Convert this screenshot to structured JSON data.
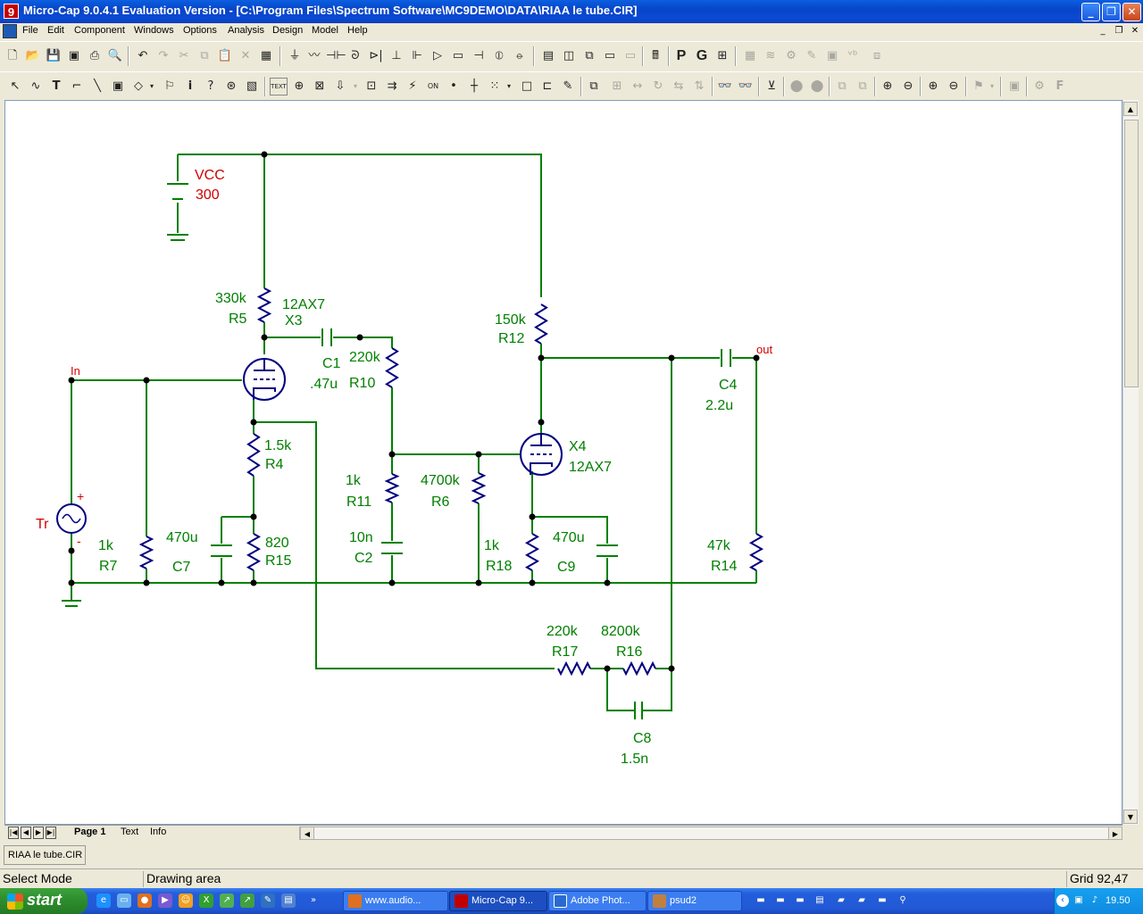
{
  "window": {
    "title": "Micro-Cap 9.0.4.1 Evaluation Version - [C:\\Program Files\\Spectrum Software\\MC9DEMO\\DATA\\RIAA le tube.CIR]",
    "app_icon": "9"
  },
  "menu": [
    "File",
    "Edit",
    "Component",
    "Windows",
    "Options",
    "Analysis",
    "Design",
    "Model",
    "Help"
  ],
  "toolbar1_text": {
    "probe_p": "P",
    "probe_g": "G"
  },
  "page_tabs": [
    "Page 1",
    "Text",
    "Info"
  ],
  "file_tab": "RIAA le tube.CIR",
  "status": {
    "mode": "Select Mode",
    "area": "Drawing area",
    "grid": "Grid 92,47"
  },
  "taskbar": {
    "start": "start",
    "tasks": [
      "www.audio...",
      "Micro-Cap 9...",
      "Adobe Phot...",
      "psud2"
    ],
    "clock": "19.50"
  },
  "schematic": {
    "wire_color": "#008000",
    "part_color": "#000080",
    "label_color": "#008000",
    "source_label_color": "#d00000",
    "parts": [
      {
        "ref": "VCC",
        "value": "300"
      },
      {
        "ref": "R5",
        "value": "330k"
      },
      {
        "ref": "X3",
        "value": "12AX7"
      },
      {
        "ref": "C1",
        "value": ".47u"
      },
      {
        "ref": "R10",
        "value": "220k"
      },
      {
        "ref": "R12",
        "value": "150k"
      },
      {
        "ref": "C4",
        "value": "2.2u"
      },
      {
        "ref": "R4",
        "value": "1.5k"
      },
      {
        "ref": "X4",
        "value": "12AX7"
      },
      {
        "ref": "R11",
        "value": "1k"
      },
      {
        "ref": "R6",
        "value": "4700k"
      },
      {
        "ref": "Tr",
        "value": ""
      },
      {
        "ref": "R7",
        "value": "1k"
      },
      {
        "ref": "C7",
        "value": "470u"
      },
      {
        "ref": "R15",
        "value": "820"
      },
      {
        "ref": "C2",
        "value": "10n"
      },
      {
        "ref": "R18",
        "value": "1k"
      },
      {
        "ref": "C9",
        "value": "470u"
      },
      {
        "ref": "R14",
        "value": "47k"
      },
      {
        "ref": "R17",
        "value": "220k"
      },
      {
        "ref": "R16",
        "value": "8200k"
      },
      {
        "ref": "C8",
        "value": "1.5n"
      }
    ],
    "nodes": {
      "in": "In",
      "out": "out"
    },
    "source_polarity": {
      "plus": "+",
      "minus": "-"
    }
  }
}
